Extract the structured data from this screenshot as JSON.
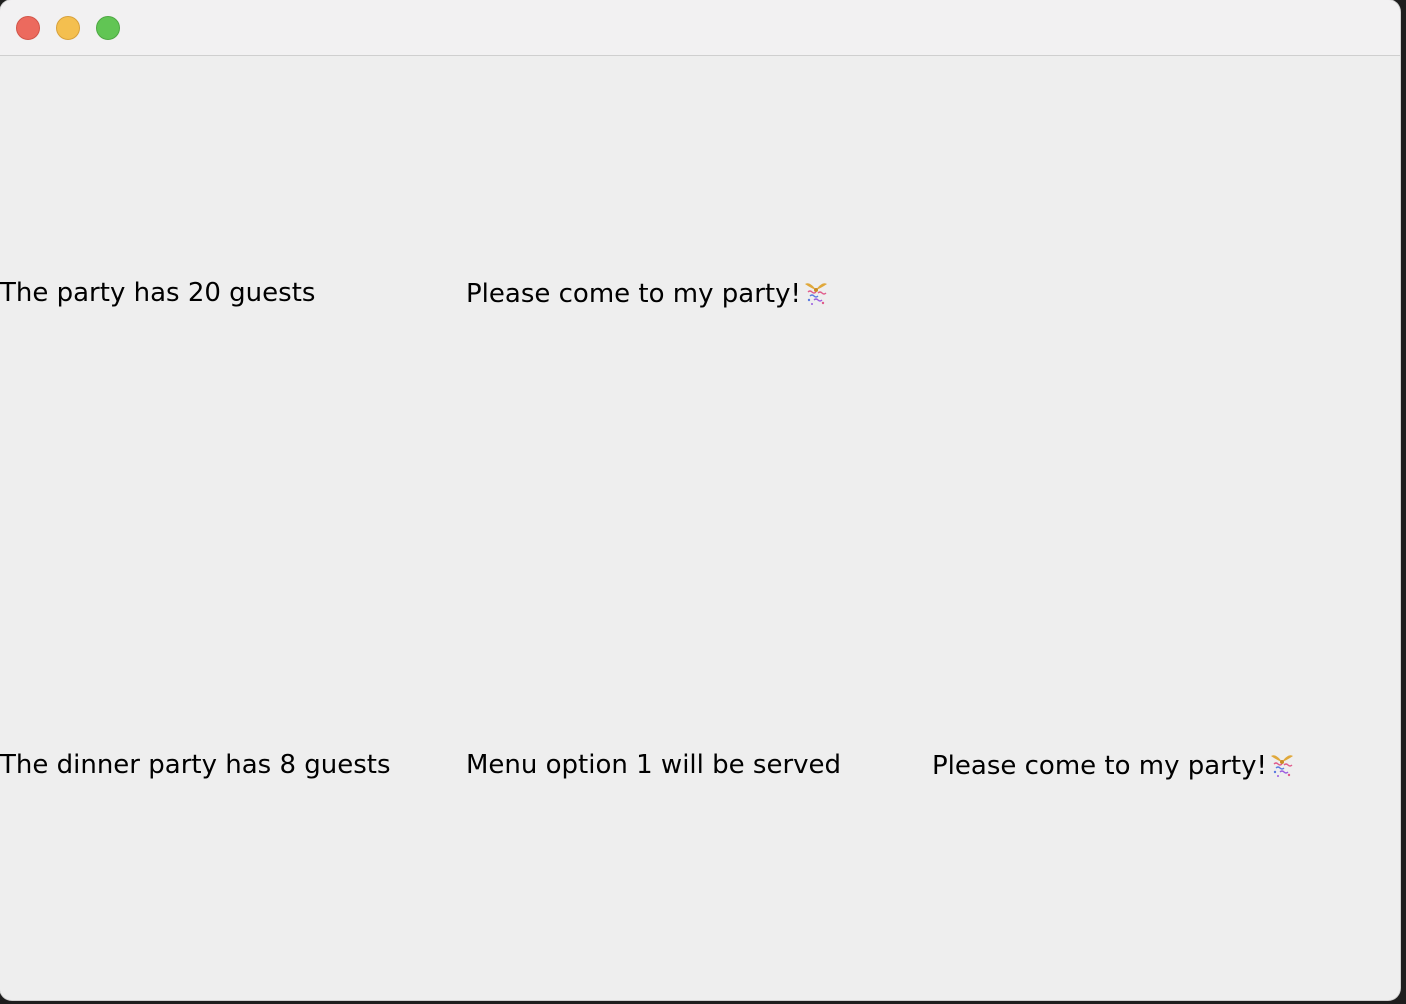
{
  "window": {
    "controls": [
      "close",
      "minimize",
      "zoom"
    ]
  },
  "grid": {
    "row1": {
      "col1": "The party has 20 guests",
      "col2": "Please come to my party!"
    },
    "row2": {
      "col1": "The dinner party has 8 guests",
      "col2": "Menu option 1 will be served",
      "col3": "Please come to my party!"
    }
  },
  "icons": {
    "party": "party-popper-icon"
  },
  "colors": {
    "window_bg": "#eeeeee",
    "titlebar_bg": "#f2f1f2",
    "close": "#ec6a5e",
    "minimize": "#f4bf4f",
    "zoom": "#61c554"
  }
}
